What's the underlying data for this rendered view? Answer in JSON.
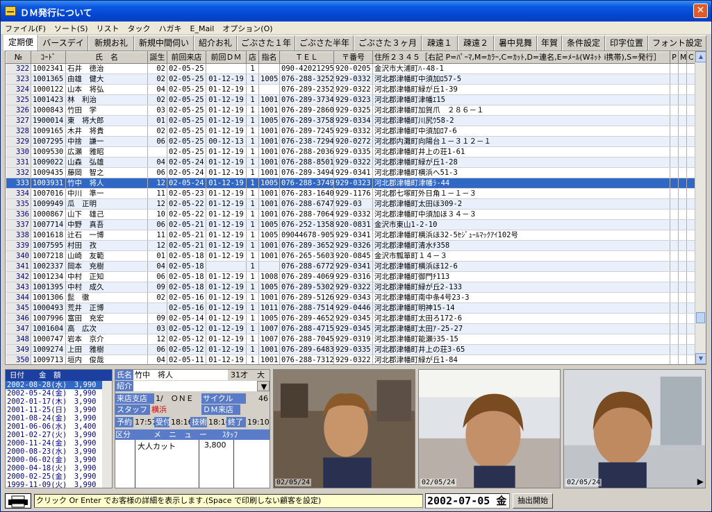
{
  "window": {
    "title": "ＤＭ発行について",
    "close": "✕"
  },
  "menu": [
    "ファイル(F)",
    "ソート(S)",
    "リスト",
    "タック",
    "ハガキ",
    "E_Mail",
    "オプション(O)"
  ],
  "tabs": [
    "定期便",
    "バースデイ",
    "新規お礼",
    "新規中間伺い",
    "紹介お礼",
    "ごぶさた１年",
    "ごぶさた半年",
    "ごぶさた３ヶ月",
    "疎遠１",
    "疎遠２",
    "暑中見舞",
    "年賀",
    "条件設定",
    "印字位置",
    "フォント設定"
  ],
  "grid": {
    "headers": [
      "№",
      "ｺｰﾄﾞ",
      "氏　名",
      "誕生",
      "前回来店",
      "前回ＤＭ",
      "店",
      "指名",
      "ＴＥＬ",
      "〒番号",
      "住所２３４５［右記 P=ﾊﾟｰﾏ,M=ｶﾗｰ,C=ｶｯﾄ,D=連名,E=ﾒｰﾙ(Wﾈｯﾄ i携帯),S=発行］",
      "P",
      "M",
      "C",
      "D",
      "E",
      "S"
    ],
    "rows": [
      [
        "322",
        "1002341",
        "石井　徳治",
        "02",
        "02-05-25",
        "",
        "1",
        "",
        "090-42021295",
        "920-0205",
        "金沢市大浦町ﾊ-48-1",
        "w"
      ],
      [
        "323",
        "1001365",
        "由雄　健大",
        "02",
        "02-05-25",
        "01-12-19",
        "1",
        "1005",
        "076-288-3252",
        "929-0332",
        "河北郡津幡町中須加ﾛ57-5",
        ""
      ],
      [
        "324",
        "1000122",
        "山本　将弘",
        "04",
        "02-05-25",
        "01-12-19",
        "1",
        "",
        "076-289-2352",
        "929-0322",
        "河北郡津幡町緑が丘1-39",
        ""
      ],
      [
        "325",
        "1001423",
        "林　利治",
        "02",
        "02-05-25",
        "01-12-19",
        "1",
        "1001",
        "076-289-3734",
        "929-0323",
        "河北郡津幡町津幡ｴ15",
        "w"
      ],
      [
        "326",
        "1000843",
        "竹田　学",
        "03",
        "02-05-25",
        "01-12-19",
        "1",
        "1001",
        "076-289-2860",
        "929-0325",
        "河北郡津幡町加賀爪　２８６－１",
        ""
      ],
      [
        "327",
        "1900014",
        "東　将大郎",
        "01",
        "02-05-25",
        "01-12-19",
        "1",
        "1005",
        "076-289-3758",
        "929-0334",
        "河北郡津幡町川尻ｳ58-2",
        ""
      ],
      [
        "328",
        "1009165",
        "木井　将貴",
        "02",
        "02-05-25",
        "01-12-19",
        "1",
        "1001",
        "076-289-7245",
        "929-0332",
        "河北郡津幡町中須加ﾛ7-6",
        "w"
      ],
      [
        "329",
        "1007295",
        "中捨　謙一",
        "06",
        "02-05-25",
        "00-12-13",
        "1",
        "1001",
        "076-238-7294",
        "920-0272",
        "河北郡内灘町向陽台１－３１２－１",
        ""
      ],
      [
        "330",
        "1009530",
        "広瀬　雅昭",
        "",
        "02-05-25",
        "01-12-19",
        "1",
        "1001",
        "076-288-2036",
        "929-0335",
        "河北郡津幡町井上の荘1-61",
        "w"
      ],
      [
        "331",
        "1009022",
        "山森　弘雄",
        "04",
        "02-05-24",
        "01-12-19",
        "1",
        "1001",
        "076-288-8501",
        "929-0322",
        "河北郡津幡町緑が丘1-28",
        ""
      ],
      [
        "332",
        "1009435",
        "藤岡　智之",
        "06",
        "02-05-24",
        "01-12-19",
        "1",
        "1001",
        "076-289-3494",
        "929-0341",
        "河北郡津幡町横浜へ51-3",
        ""
      ],
      [
        "333",
        "1003931",
        "竹中　将人",
        "12",
        "02-05-24",
        "01-12-19",
        "1",
        "1005",
        "076-288-3749",
        "929-0323",
        "河北郡津幡町津幡ﾗ-44",
        ""
      ],
      [
        "334",
        "1007016",
        "中川　準一",
        "11",
        "02-05-23",
        "01-12-19",
        "1",
        "1001",
        "076-283-1640",
        "929-1176",
        "河北郡七塚町外日角１－１－３",
        "w"
      ],
      [
        "335",
        "1009949",
        "瓜　正明",
        "12",
        "02-05-22",
        "01-12-19",
        "1",
        "1001",
        "076-288-6747",
        "929-03",
        "河北郡津幡町太田ほ309-2",
        ""
      ],
      [
        "336",
        "1000867",
        "山下　雄己",
        "10",
        "02-05-22",
        "01-12-19",
        "1",
        "1001",
        "076-288-7064",
        "929-0332",
        "河北郡津幡町中須加ほ３４－３",
        ""
      ],
      [
        "337",
        "1007714",
        "中野　真吾",
        "06",
        "02-05-21",
        "01-12-19",
        "1",
        "1005",
        "076-252-1358",
        "920-0831",
        "金沢市東山1-2-10",
        ""
      ],
      [
        "338",
        "1001618",
        "辻石　一博",
        "11",
        "02-05-21",
        "01-12-19",
        "1",
        "1005",
        "09044678-905",
        "929-0341",
        "河北郡津幡町横浜ほ32-5ｾｼﾞｭｰﾙﾏｯｸｱｲ102号",
        ""
      ],
      [
        "339",
        "1007595",
        "村田　孜",
        "12",
        "02-05-21",
        "01-12-19",
        "1",
        "1001",
        "076-289-3652",
        "929-0326",
        "河北郡津幡町清水ﾁ358",
        ""
      ],
      [
        "340",
        "1007218",
        "山崎　友範",
        "01",
        "02-05-18",
        "01-12-19",
        "1",
        "1001",
        "076-265-5603",
        "920-0845",
        "金沢市瓢箪町１４－３",
        ""
      ],
      [
        "341",
        "1002337",
        "岡本　充樹",
        "04",
        "02-05-18",
        "",
        "1",
        "",
        "076-288-6772",
        "929-0341",
        "河北郡津幡町横浜ほ12-6",
        ""
      ],
      [
        "342",
        "1001234",
        "中村　正知",
        "06",
        "02-05-18",
        "01-12-19",
        "1",
        "1008",
        "076-289-4069",
        "929-0316",
        "河北郡津幡町御門ﾁ113",
        ""
      ],
      [
        "343",
        "1001395",
        "中村　成久",
        "09",
        "02-05-18",
        "01-12-19",
        "1",
        "1005",
        "076-289-5302",
        "929-0322",
        "河北郡津幡町緑が丘2-133",
        ""
      ],
      [
        "344",
        "1001306",
        "髭　徹",
        "02",
        "02-05-16",
        "01-12-19",
        "1",
        "1001",
        "076-289-5126",
        "929-0343",
        "河北郡津幡町南中条4号23-3",
        ""
      ],
      [
        "345",
        "1000493",
        "荒井　正博",
        "",
        "02-05-16",
        "01-12-19",
        "1",
        "1011",
        "076-288-7514",
        "929-0446",
        "河北郡津幡町明神15-14",
        ""
      ],
      [
        "346",
        "1007996",
        "富田　充宏",
        "09",
        "02-05-14",
        "01-12-19",
        "1",
        "1005",
        "076-289-4652",
        "929-0345",
        "河北郡津幡町太田ろ172-6",
        ""
      ],
      [
        "347",
        "1001604",
        "高　広次",
        "03",
        "02-05-12",
        "01-12-19",
        "1",
        "1007",
        "076-288-4715",
        "929-0345",
        "河北郡津幡町太田ｱ-25-27",
        ""
      ],
      [
        "348",
        "1000747",
        "岩本　京介",
        "12",
        "02-05-12",
        "01-12-19",
        "1",
        "1007",
        "076-288-7045",
        "929-0319",
        "河北郡津幡町能瀬ﾗ35-15",
        ""
      ],
      [
        "349",
        "1009274",
        "上田　雅樹",
        "06",
        "02-05-12",
        "01-12-19",
        "1",
        "1001",
        "076-289-6483",
        "929-0335",
        "河北郡津幡町井上の荘3-65",
        "w"
      ],
      [
        "350",
        "1009713",
        "垣内　俊哉",
        "04",
        "02-05-11",
        "01-12-19",
        "1",
        "1001",
        "076-288-7312",
        "929-0322",
        "河北郡津幡町緑が丘1-84",
        ""
      ]
    ],
    "selected_row": 11
  },
  "history": {
    "header": "日付　　金　額",
    "rows": [
      "2002-08-28(水)　3,990",
      "2002-05-24(金)　3,990",
      "2002-01-17(木)　3,990",
      "2001-11-25(日)　3,990",
      "2001-08-24(金)　3,990",
      "2001-06-06(水)　3,400",
      "2001-02-27(火)　3,990",
      "2000-11-24(金)　3,990",
      "2000-08-23(水)　3,990",
      "2000-06-02(金)　3,990",
      "2000-04-18(火)　3,990",
      "2000-02-25(金)　3,990",
      "1999-11-09(火)　3,990"
    ]
  },
  "info": {
    "name_lbl": "氏名",
    "name_val": "竹中　将人",
    "age": "31才",
    "gender": "大",
    "intro_lbl": "紹介",
    "store_lbl": "来店支店",
    "store_val": "1/　ＯＮＥ",
    "cycle_lbl": "サイクル",
    "cycle_val": "46",
    "staff_lbl": "スタッフ",
    "staff_val": "横浜",
    "dm_lbl": "ＤＭ来店",
    "yoyaku_lbl": "予約",
    "yoyaku_val": "17:57",
    "uketsuke_lbl": "受付",
    "uketsuke_val": "18:16",
    "gijutsu_lbl": "技術",
    "gijutsu_val": "18:16",
    "shuryo_lbl": "終了",
    "shuryo_val": "19:10",
    "menu_hdr": "区分　　　メ　ニ　ュ　ー　　ｽﾀｯﾌ",
    "menu_item": "大人カット",
    "menu_price": "3,800"
  },
  "photos": [
    "02/05/24",
    "02/05/24",
    "02/05/24"
  ],
  "status": {
    "message": "クリック Or Enter でお客様の詳細を表示します.(Space で印刷しない顧客を設定)",
    "date": "2002-07-05 金",
    "extract": "抽出開始"
  }
}
